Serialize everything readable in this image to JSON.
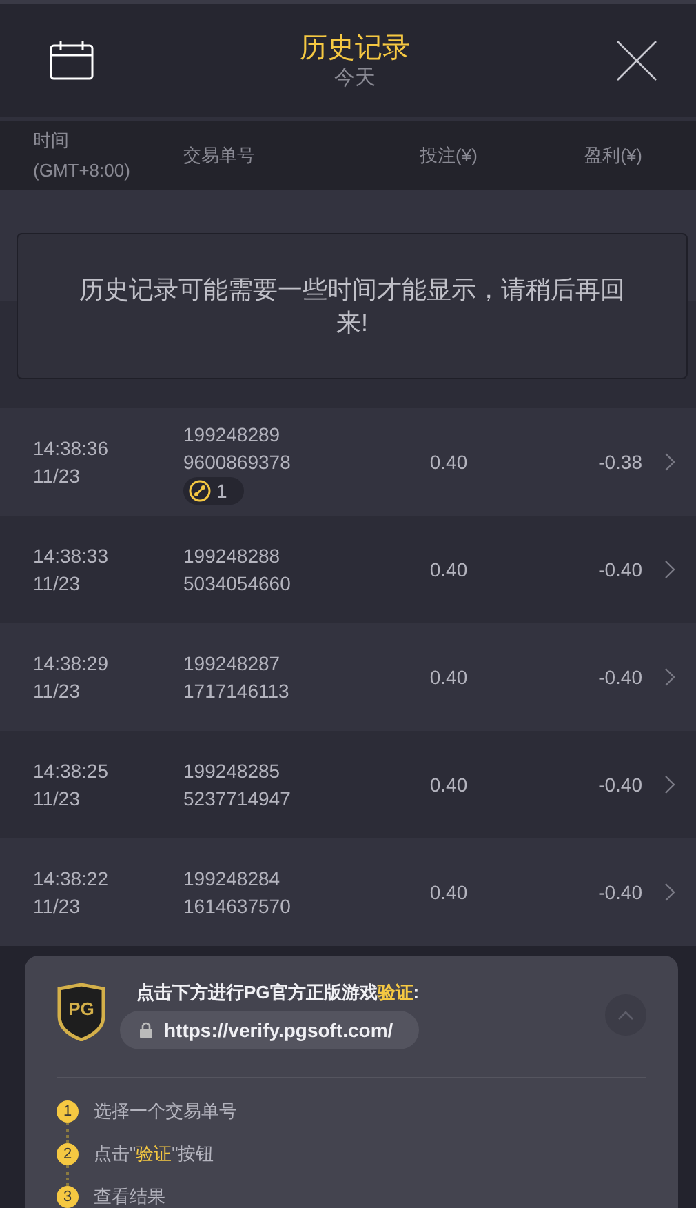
{
  "header": {
    "title": "历史记录",
    "subtitle": "今天"
  },
  "columns": [
    "时间",
    "(GMT+8:00)",
    "交易单号",
    "投注(¥)",
    "盈利(¥)"
  ],
  "toast": "历史记录可能需要一些时间才能显示，请稍后再回来!",
  "rows": [
    {
      "time": "14:38:36",
      "date": "11/23",
      "id": "199248289",
      "id2": "9600869378",
      "bet": "0.40",
      "profit": "-0.38",
      "badge": "1"
    },
    {
      "time": "14:38:33",
      "date": "11/23",
      "id": "199248288",
      "id2": "5034054660",
      "bet": "0.40",
      "profit": "-0.40"
    },
    {
      "time": "14:38:29",
      "date": "11/23",
      "id": "199248287",
      "id2": "1717146113",
      "bet": "0.40",
      "profit": "-0.40"
    },
    {
      "time": "14:38:25",
      "date": "11/23",
      "id": "199248285",
      "id2": "5237714947",
      "bet": "0.40",
      "profit": "-0.40"
    },
    {
      "time": "14:38:22",
      "date": "11/23",
      "id": "199248284",
      "id2": "1614637570",
      "bet": "0.40",
      "profit": "-0.40"
    }
  ],
  "verify": {
    "logo": "PG",
    "heading": "点击下方进行PG官方正版游戏**验证**:",
    "url": "https://verify.pgsoft.com/",
    "expanded": true,
    "steps": [
      {
        "number": "1",
        "text": "选择一个交易单号"
      },
      {
        "number": "2",
        "text": "点击\"**验证**\"按钮"
      },
      {
        "number": "3",
        "text": "查看结果"
      }
    ]
  }
}
